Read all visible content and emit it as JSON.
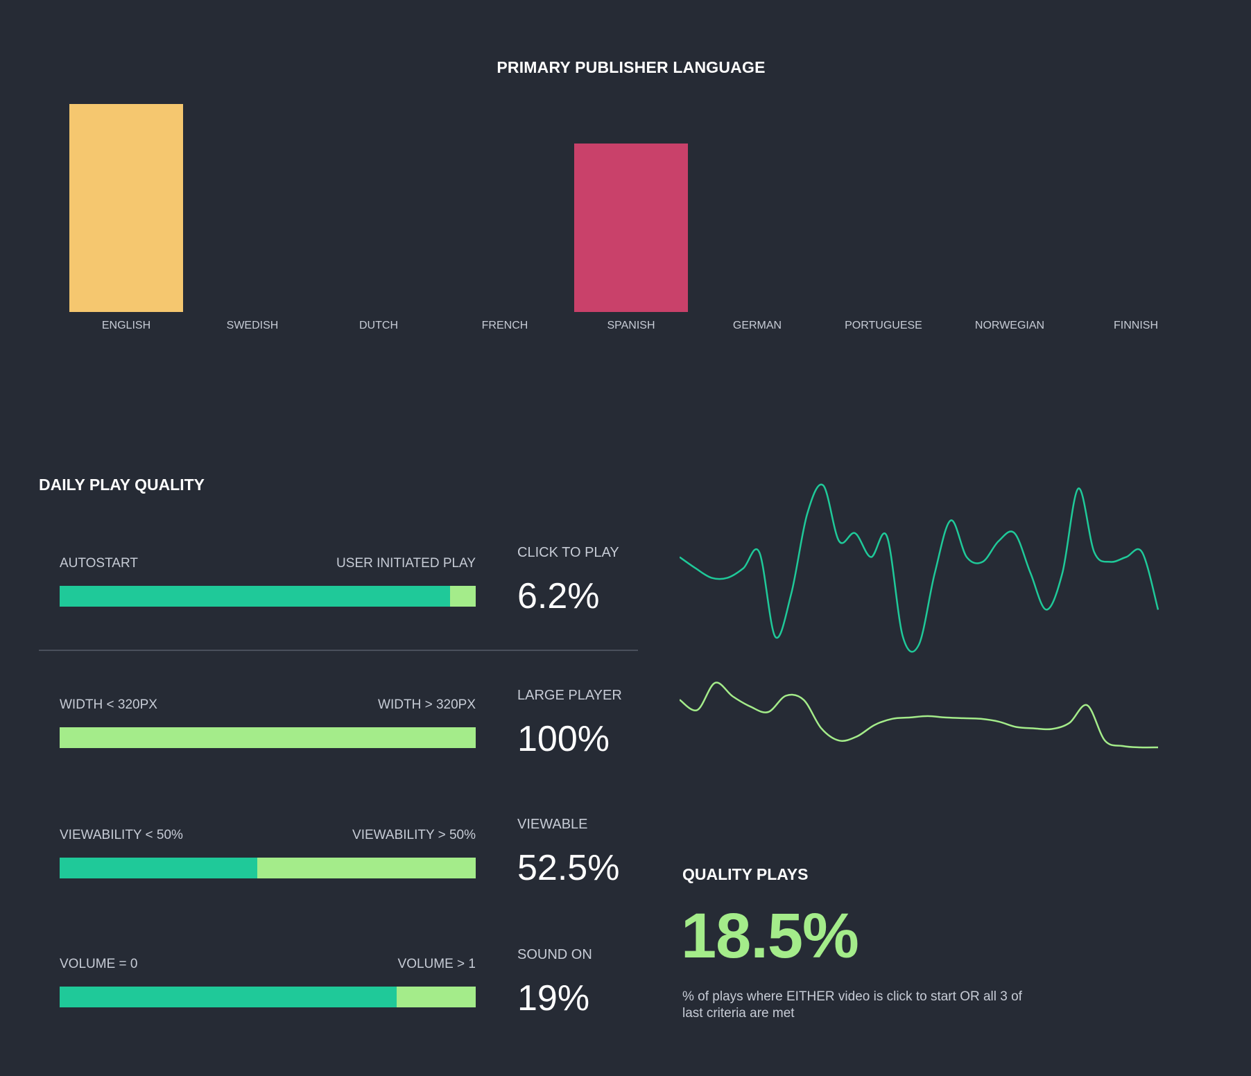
{
  "colors": {
    "background": "#262b35",
    "english_bar": "#f5c76f",
    "spanish_bar": "#c9416a",
    "dark_green": "#1fc999",
    "light_green": "#a4ec8a",
    "divider": "#4a505c"
  },
  "chart_data": [
    {
      "type": "bar",
      "title": "PRIMARY PUBLISHER LANGUAGE",
      "categories": [
        "ENGLISH",
        "SWEDISH",
        "DUTCH",
        "FRENCH",
        "SPANISH",
        "GERMAN",
        "PORTUGUESE",
        "NORWEGIAN",
        "FINNISH"
      ],
      "values": [
        100,
        0,
        0,
        0,
        81,
        0,
        0,
        0,
        0
      ],
      "bar_colors": [
        "#f5c76f",
        "#f5c76f",
        "#f5c76f",
        "#f5c76f",
        "#c9416a",
        "#f5c76f",
        "#f5c76f",
        "#f5c76f",
        "#f5c76f"
      ],
      "ylim": [
        0,
        100
      ],
      "grid": false,
      "legend": "none"
    },
    {
      "type": "line",
      "series": [
        {
          "color": "#1fc999",
          "values": [
            0.55,
            0.48,
            0.42,
            0.42,
            0.48,
            0.58,
            0.05,
            0.32,
            0.82,
            1.0,
            0.65,
            0.7,
            0.55,
            0.68,
            0.05,
            0.0,
            0.45,
            0.78,
            0.55,
            0.52,
            0.65,
            0.7,
            0.45,
            0.22,
            0.45,
            0.98,
            0.58,
            0.52,
            0.55,
            0.58,
            0.22
          ]
        },
        {
          "color": "#a4ec8a",
          "values": [
            0.7,
            0.55,
            0.95,
            0.75,
            0.6,
            0.52,
            0.76,
            0.7,
            0.28,
            0.1,
            0.16,
            0.33,
            0.42,
            0.44,
            0.46,
            0.44,
            0.43,
            0.42,
            0.38,
            0.3,
            0.28,
            0.27,
            0.36,
            0.62,
            0.1,
            0.02,
            0.0,
            0.0
          ]
        }
      ]
    }
  ],
  "daily_play_quality": {
    "title": "DAILY PLAY QUALITY",
    "rows": [
      {
        "left_label": "AUTOSTART",
        "right_label": "USER INITIATED PLAY",
        "dark_fraction": 0.938,
        "metric_label": "CLICK TO PLAY",
        "metric_value": "6.2%"
      },
      {
        "left_label": "WIDTH < 320PX",
        "right_label": "WIDTH > 320PX",
        "dark_fraction": 0.0,
        "metric_label": "LARGE PLAYER",
        "metric_value": "100%"
      },
      {
        "left_label": "VIEWABILITY < 50%",
        "right_label": "VIEWABILITY > 50%",
        "dark_fraction": 0.475,
        "metric_label": "VIEWABLE",
        "metric_value": "52.5%"
      },
      {
        "left_label": "VOLUME = 0",
        "right_label": "VOLUME > 1",
        "dark_fraction": 0.81,
        "metric_label": "SOUND ON",
        "metric_value": "19%"
      }
    ]
  },
  "quality_plays": {
    "title": "QUALITY PLAYS",
    "value": "18.5%",
    "description": "% of plays where EITHER video is click to start OR all 3 of last criteria are met"
  }
}
